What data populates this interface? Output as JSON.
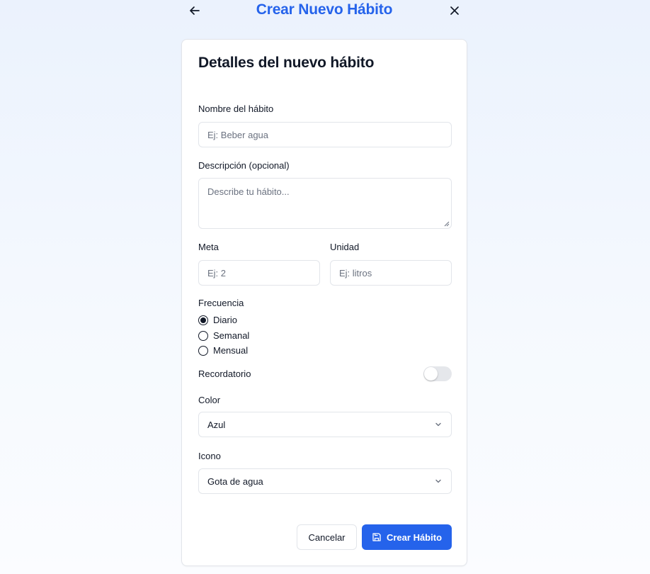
{
  "header": {
    "title": "Crear Nuevo Hábito",
    "back_icon": "arrow-left-icon",
    "close_icon": "close-icon"
  },
  "card": {
    "title": "Detalles del nuevo hábito"
  },
  "form": {
    "name": {
      "label": "Nombre del hábito",
      "placeholder": "Ej: Beber agua",
      "value": ""
    },
    "description": {
      "label": "Descripción (opcional)",
      "placeholder": "Describe tu hábito...",
      "value": ""
    },
    "goal": {
      "label": "Meta",
      "placeholder": "Ej: 2",
      "value": ""
    },
    "unit": {
      "label": "Unidad",
      "placeholder": "Ej: litros",
      "value": ""
    },
    "frequency": {
      "label": "Frecuencia",
      "options": [
        "Diario",
        "Semanal",
        "Mensual"
      ],
      "selected": "Diario"
    },
    "reminder": {
      "label": "Recordatorio",
      "enabled": false
    },
    "color": {
      "label": "Color",
      "selected": "Azul"
    },
    "icon": {
      "label": "Icono",
      "selected": "Gota de agua"
    }
  },
  "actions": {
    "cancel_label": "Cancelar",
    "create_label": "Crear Hábito",
    "create_icon": "save-icon"
  },
  "colors": {
    "accent": "#2563eb",
    "border": "#e2e5ea",
    "text": "#111827",
    "placeholder": "#6b7280"
  }
}
